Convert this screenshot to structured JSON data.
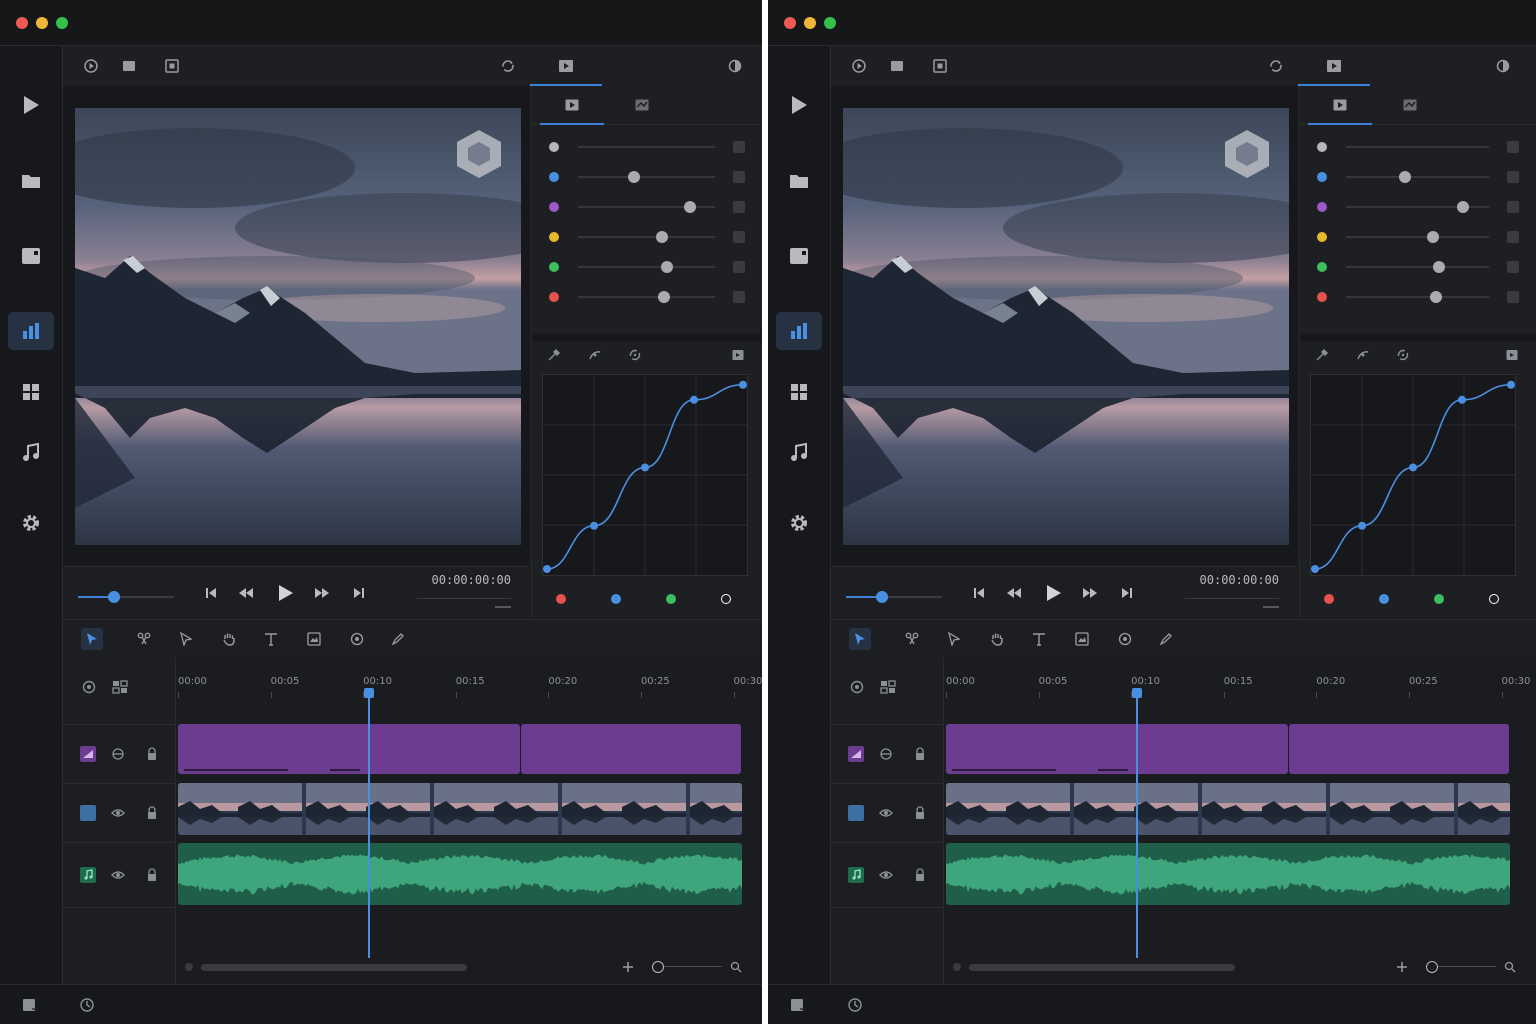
{
  "panes": [
    {
      "id": "left"
    },
    {
      "id": "right"
    }
  ],
  "sidebar": {
    "items": [
      {
        "icon": "play-icon",
        "active": false
      },
      {
        "icon": "folder-icon",
        "active": false
      },
      {
        "icon": "clips-icon",
        "active": false
      },
      {
        "icon": "bar-chart-icon",
        "active": true
      },
      {
        "icon": "grid-icon",
        "active": false
      },
      {
        "icon": "music-note-icon",
        "active": false
      },
      {
        "icon": "gear-icon",
        "active": false
      }
    ]
  },
  "transport": {
    "timecode": "00:00:00:00",
    "scrub_position": 0.38
  },
  "color_panel": {
    "sliders": [
      {
        "color": "#b5b7bb",
        "value": null
      },
      {
        "color": "#4a90e2",
        "value": 0.41
      },
      {
        "color": "#9b59c9",
        "value": 0.82
      },
      {
        "color": "#e8b92f",
        "value": 0.61
      },
      {
        "color": "#3fbf5f",
        "value": 0.65
      },
      {
        "color": "#e5534b",
        "value": 0.63
      }
    ],
    "curve_points": [
      [
        0.0,
        0.0
      ],
      [
        0.24,
        0.23
      ],
      [
        0.5,
        0.54
      ],
      [
        0.75,
        0.9
      ],
      [
        1.0,
        0.98
      ]
    ],
    "channels": [
      {
        "name": "red",
        "color": "#e5534b"
      },
      {
        "name": "blue",
        "color": "#4a90e2"
      },
      {
        "name": "green",
        "color": "#3fbf5f"
      },
      {
        "name": "luma",
        "color": "#ffffff"
      }
    ]
  },
  "timeline": {
    "ruler_labels": [
      "00:00",
      "00:05",
      "00:10",
      "00:15",
      "00:20",
      "00:25",
      "00:30"
    ],
    "playhead_time": "00:10",
    "colors": {
      "title_clip": "#6b3c90",
      "video_clip": "#2a3a4c",
      "audio_clip": "#1f5f4a",
      "playhead": "#4a90e2"
    }
  }
}
